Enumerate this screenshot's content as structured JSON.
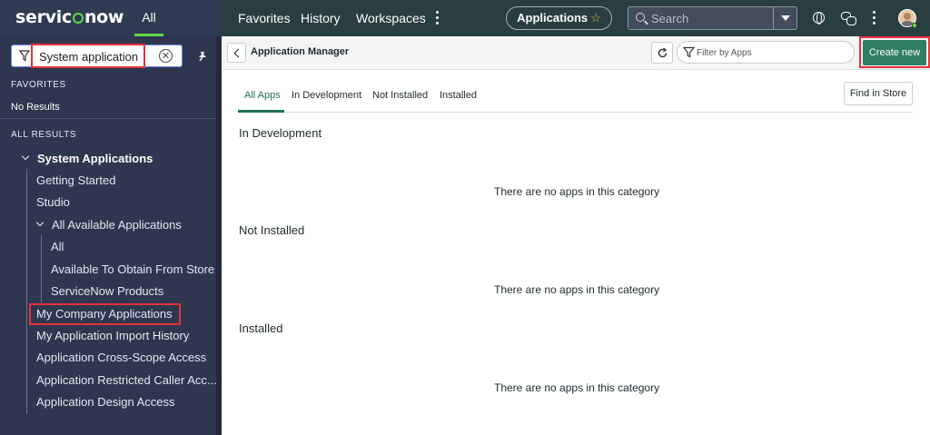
{
  "brand": {
    "name_before": "servic",
    "name_after": "now",
    "accent": "#62d84e"
  },
  "topnav": {
    "all_label": "All",
    "items": [
      "Favorites",
      "History",
      "Workspaces"
    ],
    "app_pill_label": "Applications",
    "search_placeholder": "Search"
  },
  "sidebar": {
    "filter_value": "System application",
    "favorites_label": "FAVORITES",
    "no_results": "No Results",
    "all_results_label": "ALL RESULTS",
    "group_title": "System Applications",
    "items": [
      "Getting Started",
      "Studio",
      "All Available Applications",
      "All",
      "Available To Obtain From Store",
      "ServiceNow Products",
      "My Company Applications",
      "My Application Import History",
      "Application Cross-Scope Access",
      "Application Restricted Caller Acc...",
      "Application Design Access"
    ]
  },
  "main": {
    "title": "Application Manager",
    "filter_placeholder": "Filter by Apps",
    "create_label": "Create new",
    "find_store_label": "Find in Store",
    "tabs": [
      "All Apps",
      "In Development",
      "Not Installed",
      "Installed"
    ],
    "categories": [
      {
        "title": "In Development",
        "empty": "There are no apps in this category"
      },
      {
        "title": "Not Installed",
        "empty": "There are no apps in this category"
      },
      {
        "title": "Installed",
        "empty": "There are no apps in this category"
      }
    ]
  },
  "colors": {
    "highlight": "#e53238",
    "primary_button": "#2e7d64"
  }
}
